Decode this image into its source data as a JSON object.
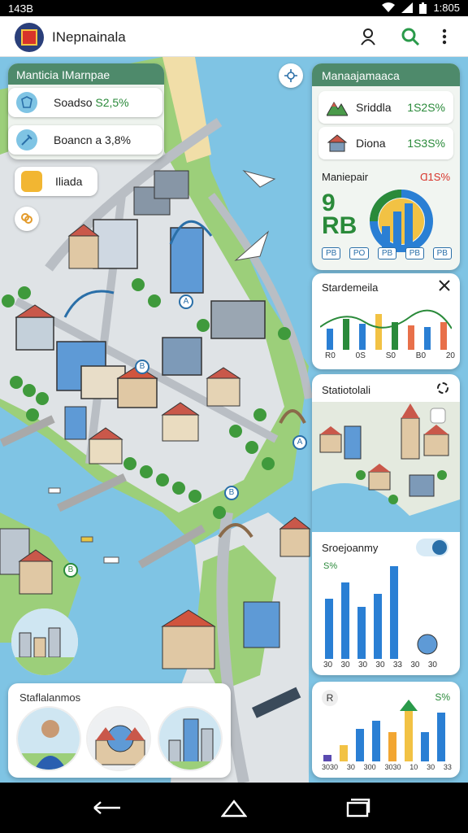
{
  "status_bar": {
    "time_left": "14ЗB",
    "time_right": "1:805"
  },
  "app_bar": {
    "title": "INepnainala",
    "icons": [
      "profile-icon",
      "search-icon",
      "more-icon"
    ]
  },
  "left_panel": {
    "title": "Manticia IMarnpae",
    "rows": [
      {
        "label": "Soadso",
        "value": "S2,5%",
        "icon": "shield-icon"
      },
      {
        "label": "Boancn a 3,8%",
        "value": "",
        "icon": "wrench-icon"
      }
    ],
    "pill_label": "Iliada",
    "mini_icon": "bouquet-icon",
    "locate_icon": "crosshair-icon"
  },
  "right_panel": {
    "title": "Manaajamaaca",
    "rows": [
      {
        "label": "Sriddla",
        "value": "1S2S%",
        "icon": "mountain-icon"
      },
      {
        "label": "Diona",
        "value": "1S3S%",
        "icon": "hut-icon"
      }
    ],
    "metric_label": "Maniepair",
    "metric_value": "Ɑ1S%",
    "big_value": "9\nRB",
    "tags": [
      "PB",
      "PO",
      "PB",
      "PB",
      "PB"
    ],
    "colors": {
      "green": "#2a8a3a",
      "blue": "#2a7fd4",
      "yellow": "#f2c244",
      "header": "#4e8a6b"
    }
  },
  "statistics_card": {
    "title": "Stardemeila",
    "axis": [
      "R0",
      "0S",
      "S0",
      "B0",
      "20"
    ]
  },
  "map_card": {
    "title": "Statiotolali",
    "second_title": "Sroejoanmy",
    "second_pct": "S%",
    "axis": [
      "30",
      "30",
      "30",
      "30",
      "33",
      "30",
      "30"
    ]
  },
  "bottom_right_card": {
    "icon_letter": "R",
    "pct": "S%",
    "axis": [
      "3030",
      "30",
      "300",
      "3030",
      "10",
      "30",
      "33"
    ]
  },
  "bottom_card": {
    "title": "Staflalanmos",
    "circles": [
      "person-photo",
      "dome-building-photo",
      "towers-photo"
    ]
  },
  "map_labels": [
    "A",
    "B",
    "B",
    "A",
    "B"
  ],
  "nav_bar": [
    "back-button",
    "home-button",
    "recents-button"
  ]
}
